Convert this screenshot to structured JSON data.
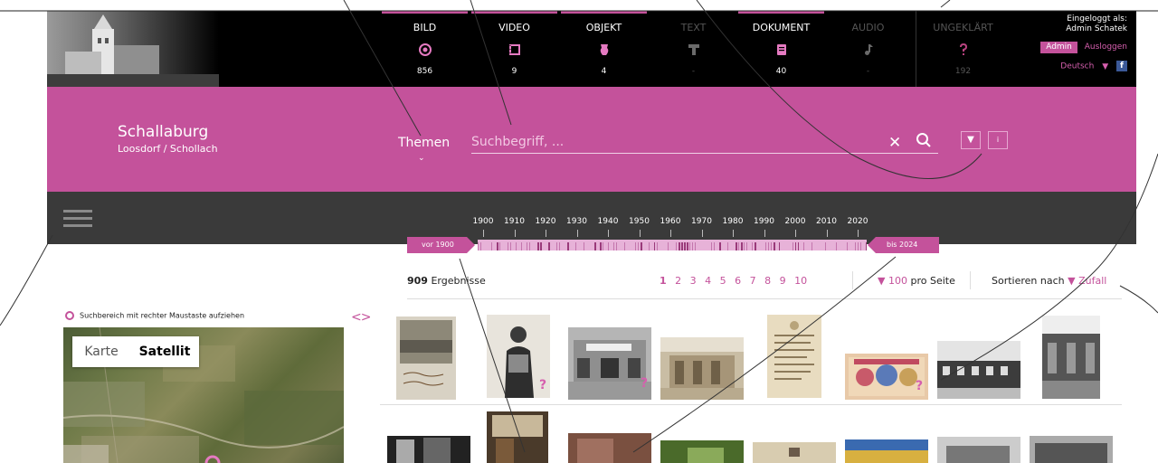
{
  "media_tabs": [
    {
      "label": "BILD",
      "count": "856",
      "icon": "image-circle-icon"
    },
    {
      "label": "VIDEO",
      "count": "9",
      "icon": "film-icon"
    },
    {
      "label": "OBJEKT",
      "count": "4",
      "icon": "vase-icon"
    },
    {
      "label": "TEXT",
      "count": "-",
      "icon": "text-t-icon"
    },
    {
      "label": "DOKUMENT",
      "count": "40",
      "icon": "document-icon"
    },
    {
      "label": "AUDIO",
      "count": "-",
      "icon": "music-note-icon"
    },
    {
      "label": "UNGEKLÄRT",
      "count": "192",
      "icon": "question-icon"
    }
  ],
  "user": {
    "logged_in_label": "Eingeloggt als:",
    "name": "Admin Schatek",
    "role_badge": "Admin",
    "logout": "Ausloggen",
    "language": "Deutsch",
    "facebook": "f"
  },
  "site": {
    "title": "Schallaburg",
    "subtitle": "Loosdorf / Schollach"
  },
  "search": {
    "themes_label": "Themen",
    "placeholder": "Suchbegriff, ...",
    "filter_caret": "▼",
    "info_label": "i"
  },
  "timeline": {
    "years": [
      "1900",
      "1910",
      "1920",
      "1930",
      "1940",
      "1950",
      "1960",
      "1970",
      "1980",
      "1990",
      "2000",
      "2010",
      "2020"
    ],
    "start_label": "vor 1900",
    "end_label": "bis 2024"
  },
  "results": {
    "count": "909",
    "count_label": "Ergebnisse",
    "pages": [
      "1",
      "2",
      "3",
      "4",
      "5",
      "6",
      "7",
      "8",
      "9",
      "10"
    ],
    "current_page": "1",
    "per_page_caret": "▼",
    "per_page_value": "100",
    "per_page_label": "pro Seite",
    "sort_label": "Sortieren nach",
    "sort_caret": "▼",
    "sort_value": "Zufall"
  },
  "map": {
    "hint": "Suchbereich mit rechter Maustaste aufziehen",
    "collapse": "<>",
    "btn_map": "Karte",
    "btn_satellite": "Satellit"
  },
  "colors": {
    "accent": "#c4529b",
    "dark_bar": "#3a3a3a",
    "top_bar": "#000000"
  }
}
